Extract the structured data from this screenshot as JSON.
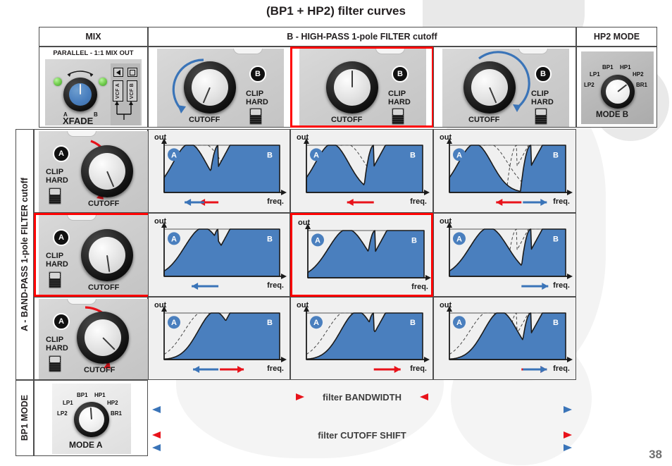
{
  "title": "(BP1 + HP2) filter curves",
  "page_number": "38",
  "colors": {
    "fill_blue": "#4a7fbe",
    "highlight_red": "#ff0000",
    "arrow_red": "#e8121a",
    "arrow_blue": "#3a74b8",
    "badge_black": "#111111",
    "panel_grey": "#cfcfcf"
  },
  "headers": {
    "mix": "MIX",
    "column_group": "B - HIGH-PASS 1-pole FILTER cutoff",
    "hp2_mode": "HP2 MODE",
    "row_group": "A - BAND-PASS 1-pole FILTER cutoff",
    "bp1_mode": "BP1 MODE"
  },
  "mix_panel": {
    "caption": "PARALLEL - 1:1 MIX OUT",
    "knob_label": "XFADE",
    "left_mark": "A",
    "right_mark": "B",
    "vcf_a": "VCF A",
    "vcf_b": "VCF B"
  },
  "mode_knobs": {
    "hp2": {
      "caption": "MODE B",
      "positions": [
        "LP2",
        "LP1",
        "BP1",
        "HP1",
        "HP2",
        "BR1"
      ],
      "selected": "HP2"
    },
    "bp1": {
      "caption": "MODE A",
      "positions": [
        "LP2",
        "LP1",
        "BP1",
        "HP1",
        "HP2",
        "BR1"
      ],
      "selected": "BP1"
    }
  },
  "filter_b_cells": [
    {
      "badge": "B",
      "cutoff_label": "CUTOFF",
      "clip_label_1": "CLIP",
      "clip_label_2": "HARD",
      "arc": "ccw-blue",
      "selected": false
    },
    {
      "badge": "B",
      "cutoff_label": "CUTOFF",
      "clip_label_1": "CLIP",
      "clip_label_2": "HARD",
      "arc": "none",
      "selected": true
    },
    {
      "badge": "B",
      "cutoff_label": "CUTOFF",
      "clip_label_1": "CLIP",
      "clip_label_2": "HARD",
      "arc": "cw-blue",
      "selected": false
    }
  ],
  "filter_a_cells": [
    {
      "badge": "A",
      "cutoff_label": "CUTOFF",
      "clip_label_1": "CLIP",
      "clip_label_2": "HARD",
      "arc": "cw-red",
      "selected": false
    },
    {
      "badge": "A",
      "cutoff_label": "CUTOFF",
      "clip_label_1": "CLIP",
      "clip_label_2": "HARD",
      "arc": "none",
      "selected": true
    },
    {
      "badge": "A",
      "cutoff_label": "CUTOFF",
      "clip_label_1": "CLIP",
      "clip_label_2": "HARD",
      "arc": "cw-red-low",
      "selected": false
    }
  ],
  "graph_axis": {
    "y_label": "out",
    "x_label": "freq.",
    "marker_a": "A",
    "marker_b": "B"
  },
  "legend": {
    "bandwidth": "filter BANDWIDTH",
    "cutoff_shift": "filter CUTOFF SHIFT"
  },
  "chart_data": {
    "type": "line",
    "title": "(BP1 + HP2) filter curves",
    "xlabel": "freq.",
    "ylabel": "out",
    "grid": false,
    "legend_position": "in-plot",
    "description": "3x3 matrix of overlaid band-pass (A) and high-pass (B) response curves; blue shaded area is the resulting mixed output.",
    "row_labels": [
      "A cutoff low",
      "A cutoff mid",
      "A cutoff high"
    ],
    "col_labels": [
      "B cutoff low",
      "B cutoff mid",
      "B cutoff high"
    ],
    "cells": [
      {
        "row": 0,
        "col": 0,
        "a_peak": 0.22,
        "a_width": 0.3,
        "b_corner": 0.47,
        "selected": false,
        "arrows": [
          "red-left",
          "blue-left"
        ]
      },
      {
        "row": 0,
        "col": 1,
        "a_peak": 0.22,
        "a_width": 0.3,
        "b_corner": 0.58,
        "selected": false,
        "arrows": [
          "red-left"
        ]
      },
      {
        "row": 0,
        "col": 2,
        "a_peak": 0.22,
        "a_width": 0.3,
        "b_corner": 0.7,
        "selected": false,
        "arrows": [
          "red-left",
          "blue-right"
        ]
      },
      {
        "row": 1,
        "col": 0,
        "a_peak": 0.34,
        "a_width": 0.34,
        "b_corner": 0.47,
        "selected": false,
        "arrows": [
          "blue-left"
        ]
      },
      {
        "row": 1,
        "col": 1,
        "a_peak": 0.34,
        "a_width": 0.34,
        "b_corner": 0.58,
        "selected": true,
        "arrows": []
      },
      {
        "row": 1,
        "col": 2,
        "a_peak": 0.34,
        "a_width": 0.34,
        "b_corner": 0.7,
        "selected": false,
        "arrows": [
          "blue-right"
        ]
      },
      {
        "row": 2,
        "col": 0,
        "a_peak": 0.44,
        "a_width": 0.3,
        "b_corner": 0.47,
        "selected": false,
        "arrows": [
          "blue-left",
          "red-right"
        ]
      },
      {
        "row": 2,
        "col": 1,
        "a_peak": 0.44,
        "a_width": 0.3,
        "b_corner": 0.58,
        "selected": false,
        "arrows": [
          "red-right"
        ]
      },
      {
        "row": 2,
        "col": 2,
        "a_peak": 0.44,
        "a_width": 0.3,
        "b_corner": 0.7,
        "selected": false,
        "arrows": [
          "red-right",
          "blue-right"
        ]
      }
    ]
  }
}
